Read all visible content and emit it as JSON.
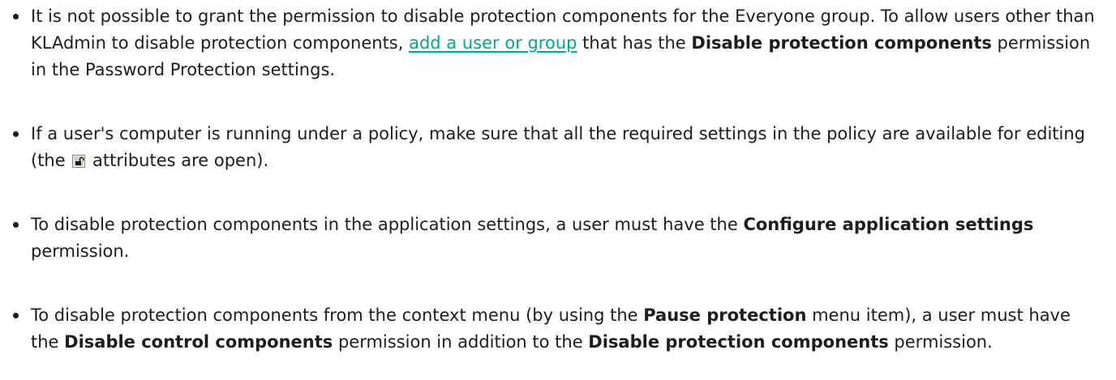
{
  "items": [
    {
      "t1": "It is not possible to grant the permission to disable protection components for the Everyone group. To allow users other than KLAdmin to disable protection components, ",
      "link": "add a user or group",
      "t2": " that has the ",
      "b1": "Disable protection components",
      "t3": " permission in the Password Protection settings."
    },
    {
      "t1": "If a user's computer is running under a policy, make sure that all the required settings in the policy are available for editing (the ",
      "icon": "open-lock-icon",
      "t2": " attributes are open)."
    },
    {
      "t1": "To disable protection components in the application settings, a user must have the ",
      "b1": "Configure application settings",
      "t2": " permission."
    },
    {
      "t1": "To disable protection components from the context menu (by using the ",
      "b1": "Pause protection",
      "t2": " menu item), a user must have the ",
      "b2": "Disable control components",
      "t3": " permission in addition to the ",
      "b3": "Disable protection components",
      "t4": " permission."
    }
  ],
  "colors": {
    "text": "#1d1d1b",
    "link": "#00a88e"
  }
}
